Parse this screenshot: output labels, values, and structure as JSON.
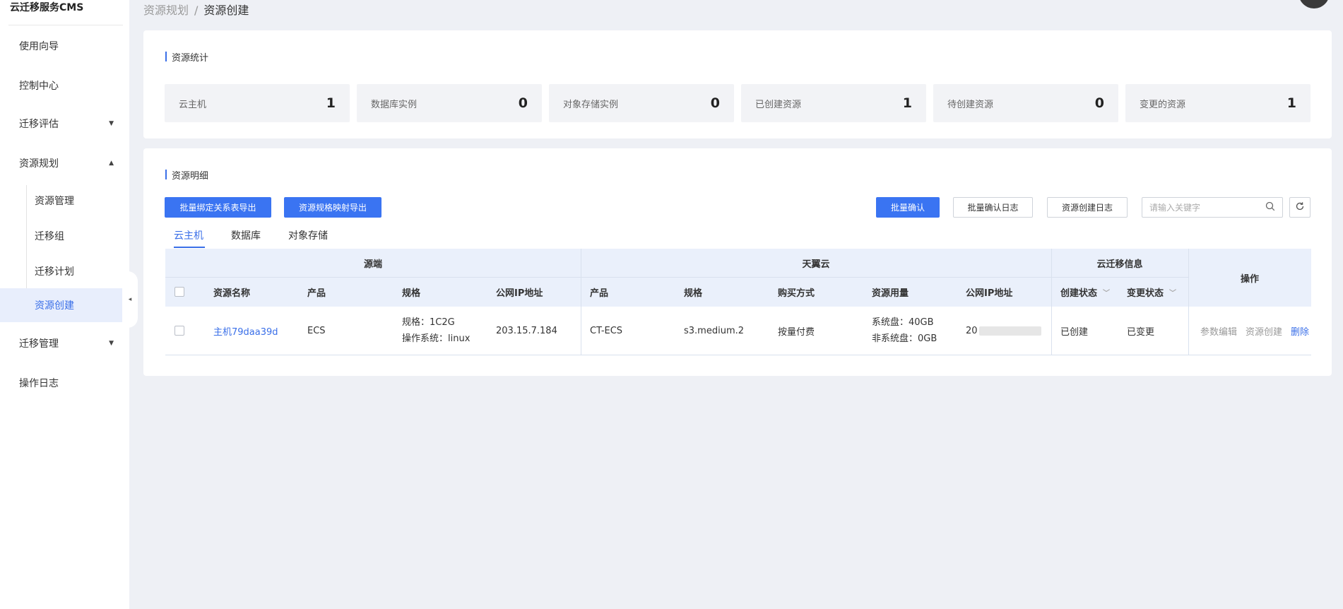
{
  "app": {
    "brand": "云迁移服务CMS"
  },
  "sidebar": {
    "items": [
      {
        "label": "使用向导"
      },
      {
        "label": "控制中心"
      },
      {
        "label": "迁移评估",
        "caret": "▼"
      },
      {
        "label": "资源规划",
        "caret": "▲"
      },
      {
        "label": "迁移管理",
        "caret": "▼"
      },
      {
        "label": "操作日志"
      }
    ],
    "sub_items": [
      {
        "label": "资源管理"
      },
      {
        "label": "迁移组"
      },
      {
        "label": "迁移计划"
      },
      {
        "label": "资源创建"
      }
    ],
    "collapse_icon": "◂"
  },
  "breadcrumb": {
    "parent": "资源规划",
    "sep": "/",
    "current": "资源创建"
  },
  "stats_card": {
    "title": "资源统计",
    "stats": [
      {
        "label": "云主机",
        "value": "1"
      },
      {
        "label": "数据库实例",
        "value": "0"
      },
      {
        "label": "对象存储实例",
        "value": "0"
      },
      {
        "label": "已创建资源",
        "value": "1"
      },
      {
        "label": "待创建资源",
        "value": "0"
      },
      {
        "label": "变更的资源",
        "value": "1"
      }
    ]
  },
  "detail_card": {
    "title": "资源明细",
    "export_bind_label": "批量绑定关系表导出",
    "export_spec_label": "资源规格映射导出",
    "batch_confirm_label": "批量确认",
    "batch_confirm_log_label": "批量确认日志",
    "create_log_label": "资源创建日志",
    "search_placeholder": "请输入关键字",
    "search_icon": "search-icon",
    "refresh_icon": "refresh-icon",
    "tabs": [
      {
        "label": "云主机"
      },
      {
        "label": "数据库"
      },
      {
        "label": "对象存储"
      }
    ],
    "table": {
      "groups": {
        "source": "源端",
        "target": "天翼云",
        "migration": "云迁移信息",
        "ops": "操作"
      },
      "headers": {
        "name": "资源名称",
        "src_product": "产品",
        "src_spec": "规格",
        "src_ip": "公网IP地址",
        "dst_product": "产品",
        "dst_spec": "规格",
        "purchase": "购买方式",
        "usage": "资源用量",
        "dst_ip": "公网IP地址",
        "create_status": "创建状态",
        "change_status": "变更状态",
        "filter_caret": "﹀"
      },
      "rows": [
        {
          "name": "主机79daa39d",
          "src_product": "ECS",
          "src_spec_line1": "规格：1C2G",
          "src_spec_line2": "操作系统：linux",
          "src_ip": "203.15.7.184",
          "dst_product": "CT-ECS",
          "dst_spec": "s3.medium.2",
          "purchase": "按量付费",
          "usage_line1": "系统盘：40GB",
          "usage_line2": "非系统盘：0GB",
          "dst_ip_prefix": "20",
          "create_status": "已创建",
          "change_status": "已变更",
          "op_edit": "参数编辑",
          "op_create": "资源创建",
          "op_delete": "删除"
        }
      ]
    }
  }
}
